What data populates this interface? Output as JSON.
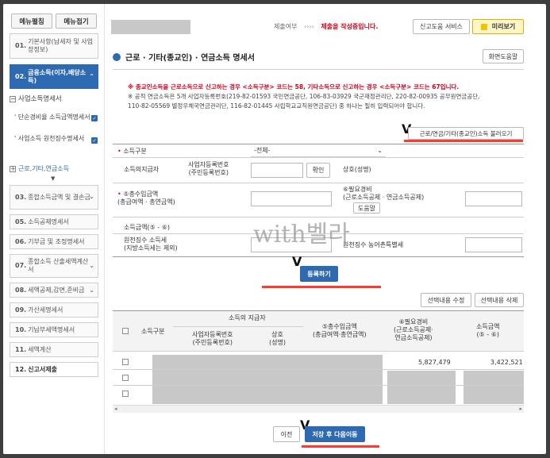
{
  "sidebar": {
    "expand_label": "메뉴펼침",
    "collapse_label": "메뉴접기",
    "items": [
      {
        "num": "01.",
        "label": "기본사항(납세자 및 사업장정보)"
      },
      {
        "num": "02.",
        "label": "금융소득(이자,배당소득)"
      },
      {
        "num": "03.",
        "label": "종합소득금액 및 결손금"
      },
      {
        "num": "05.",
        "label": "소득공제명세서"
      },
      {
        "num": "06.",
        "label": "기부금 및 조정명세서"
      },
      {
        "num": "07.",
        "label": "종합소득 산출세액계산서"
      },
      {
        "num": "08.",
        "label": "세액공제,감면,준비금"
      },
      {
        "num": "09.",
        "label": "가산세명세서"
      },
      {
        "num": "10.",
        "label": "기납부세액명세서"
      },
      {
        "num": "11.",
        "label": "세액계산"
      },
      {
        "num": "12.",
        "label": "신고서제출"
      }
    ],
    "section_label": "사업소득명세서",
    "sub_items": [
      "단순경비율 소득금액명세서",
      "사업소득 원천징수명세서"
    ],
    "expand_item": "근로,기타,연금소득"
  },
  "header": {
    "submit_status": "제출여부",
    "arrows": "››››",
    "writing_notice": "제출을 작성중입니다.",
    "help_service": "신고도움 서비스",
    "preview": "미리보기"
  },
  "page_title": "근로 · 기타(종교인) · 연금소득 명세서",
  "screen_help": "화면도움말",
  "notice_lines": [
    "※ 종교인소득을 근로소득으로 신고하는 경우 <소득구분> 코드는 58, 기타소득으로 신고하는 경우 <소득구분> 코드는 67입니다.",
    "※ 공적 연금소득은 5개 사업자등록번호(219-82-01593 국민연금공단, 106-83-03929 국군재정관리단, 220-82-00935 공무원연금공단,",
    "110-82-05569 별정우체국연금관리단, 116-82-01445 사립학교교직원연금공단) 중 하나는 필히 입력되어야 합니다."
  ],
  "load_button": "근로/연금/기타(종교인)소득 불러오기",
  "form": {
    "income_type_label": "소득구분",
    "income_type_value": "-전체-",
    "payer_label": "소득의지급자",
    "biz_no_label": "사업자등록번호\n(주민등록번호)",
    "confirm_button": "확인",
    "trade_name_label": "상호(성명)",
    "total_income_label": "⑤총수입금액\n(총급여액 · 총연금액)",
    "necessary_expense_label": "⑥필요경비\n(근로소득공제 · 연금소득공제)",
    "help_button": "도움말",
    "income_amount_label": "소득금액(⑤ - ⑥)",
    "withholding_label": "원천징수 소득세\n(지방소득세는 제외)",
    "rural_tax_label": "원천징수 농어촌특별세"
  },
  "register_button": "등록하기",
  "edit_button": "선택내용 수정",
  "delete_button": "선택내용 삭제",
  "table": {
    "headers": {
      "income_type": "소득구분",
      "payer": "소득의 지급자",
      "biz_no": "사업자등록번호\n(주민등록번호)",
      "trade_name": "상호\n(성명)",
      "total_income": "⑤총수입금액\n(총급여액·총연금액)",
      "necessary_expense": "⑥필요경비\n(근로소득공제·\n연금소득공제)",
      "income_amount": "소득금액\n(⑤ - ⑥)"
    },
    "rows": [
      {
        "necessary_expense": "5,827,479",
        "income_amount": "3,422,521"
      },
      {
        "necessary_expense": "",
        "income_amount": ""
      },
      {
        "necessary_expense": "",
        "income_amount": ""
      }
    ]
  },
  "prev_button": "이전",
  "save_next_button": "저장 후 다음이동",
  "marker": "V",
  "watermark": "with벨라",
  "colors": {
    "accent": "#2d6ab1",
    "highlight": "#ff3b2f",
    "notice_red": "#d0021b"
  }
}
